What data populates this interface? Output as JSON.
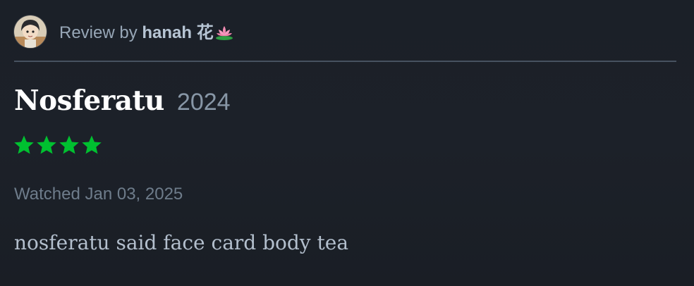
{
  "review": {
    "by_prefix": "Review by",
    "username": "hanah 花",
    "username_emoji": "lotus-icon",
    "film_title": "Nosferatu",
    "film_year": "2024",
    "rating_stars": 4,
    "rating_max": 5,
    "watched": "Watched Jan 03, 2025",
    "body": "nosferatu said face card body tea"
  },
  "colors": {
    "star": "#00c030",
    "background": "#1b2028",
    "divider": "#475260"
  }
}
